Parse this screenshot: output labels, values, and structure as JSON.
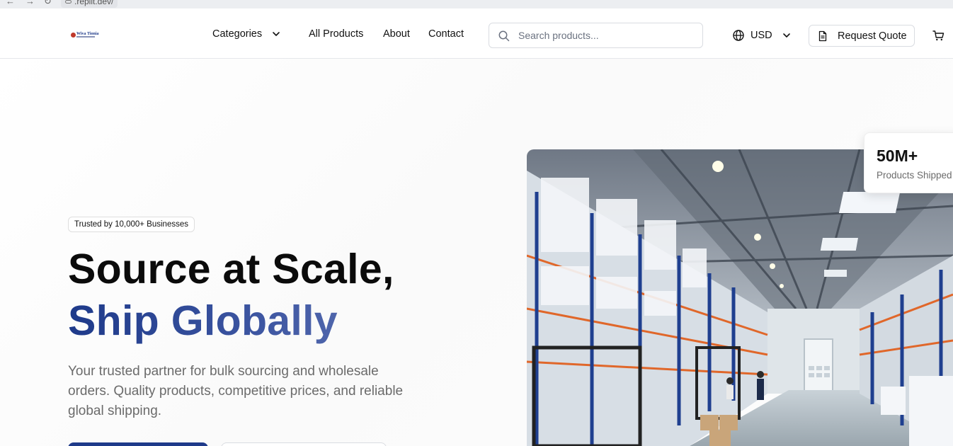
{
  "browser": {
    "url": ".replit.dev/"
  },
  "header": {
    "logo_text": "Wiva Tionia",
    "nav": {
      "categories": "Categories",
      "all_products": "All Products",
      "about": "About",
      "contact": "Contact"
    },
    "search_placeholder": "Search products...",
    "currency": "USD",
    "request_quote": "Request Quote"
  },
  "hero": {
    "badge": "Trusted by 10,000+ Businesses",
    "title_line1": "Source at Scale,",
    "title_line2": "Ship Globally",
    "description": "Your trusted partner for bulk sourcing and wholesale orders. Quality products, competitive prices, and reliable global shipping.",
    "stat_value": "50M+",
    "stat_label": "Products Shipped"
  },
  "colors": {
    "brand": "#1e3a8a",
    "text": "#111111",
    "muted": "#6b6b6b"
  }
}
